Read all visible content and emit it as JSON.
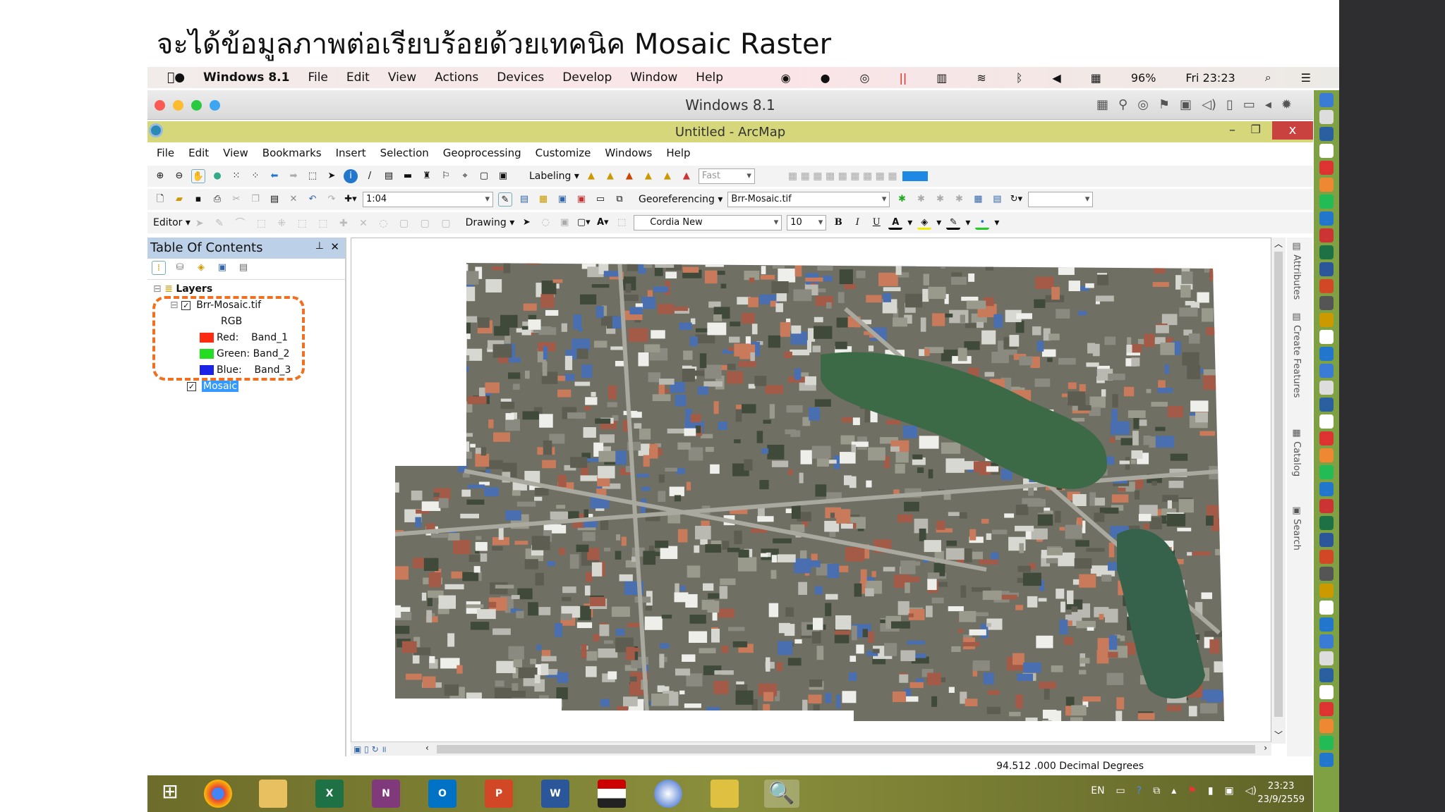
{
  "slide_title": "จะได้ข้อมูลภาพต่อเรียบร้อยด้วยเทคนิค Mosaic Raster",
  "mac_menu": {
    "app": "Windows 8.1",
    "items": [
      "File",
      "Edit",
      "View",
      "Actions",
      "Devices",
      "Develop",
      "Window",
      "Help"
    ],
    "battery": "96%",
    "clock": "Fri 23:23"
  },
  "vm_window": {
    "title": "Windows 8.1"
  },
  "arcmap": {
    "title": "Untitled - ArcMap",
    "close": "x",
    "menu": [
      "File",
      "Edit",
      "View",
      "Bookmarks",
      "Insert",
      "Selection",
      "Geoprocessing",
      "Customize",
      "Windows",
      "Help"
    ],
    "toolbar": {
      "labeling": "Labeling",
      "fast": "Fast",
      "scale": "1:04",
      "georeferencing": "Georeferencing",
      "geo_layer": "Brr-Mosaic.tif",
      "editor": "Editor",
      "drawing": "Drawing",
      "font": "Cordia New",
      "font_size": "10",
      "bold": "B",
      "italic": "I",
      "underline": "U"
    },
    "toc": {
      "title": "Table Of Contents",
      "layers": "Layers",
      "layer1": "Brr-Mosaic.tif",
      "rgb": "RGB",
      "bands": [
        {
          "label": "Red:",
          "band": "Band_1",
          "color": "#ff2a12"
        },
        {
          "label": "Green:",
          "band": "Band_2",
          "color": "#22dd22"
        },
        {
          "label": "Blue:",
          "band": "Band_3",
          "color": "#1a22e8"
        }
      ],
      "layer2": "Mosaic"
    },
    "side_tabs": [
      "Attributes",
      "Create Features",
      "Catalog",
      "Search"
    ],
    "status": "94.512  .000 Decimal Degrees"
  },
  "taskbar": {
    "lang": "EN",
    "time": "23:23",
    "date": "23/9/2559"
  }
}
